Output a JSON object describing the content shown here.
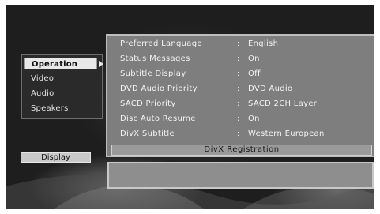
{
  "menu": {
    "items": [
      {
        "label": "Operation",
        "selected": true
      },
      {
        "label": "Video",
        "selected": false
      },
      {
        "label": "Audio",
        "selected": false
      },
      {
        "label": "Speakers",
        "selected": false
      }
    ]
  },
  "settings": {
    "separator": ":",
    "rows": [
      {
        "label": "Preferred Language",
        "value": "English"
      },
      {
        "label": "Status Messages",
        "value": "On"
      },
      {
        "label": "Subtitle Display",
        "value": "Off"
      },
      {
        "label": "DVD Audio Priority",
        "value": "DVD Audio"
      },
      {
        "label": "SACD Priority",
        "value": "SACD 2CH Layer"
      },
      {
        "label": "Disc Auto Resume",
        "value": "On"
      },
      {
        "label": "DivX Subtitle",
        "value": "Western European"
      }
    ],
    "registration_button": "DivX Registration"
  },
  "display_button": "Display",
  "colors": {
    "background": "#1e1e1e",
    "panel": "#7e7e7e",
    "selected_item": "#e8e8e8"
  }
}
